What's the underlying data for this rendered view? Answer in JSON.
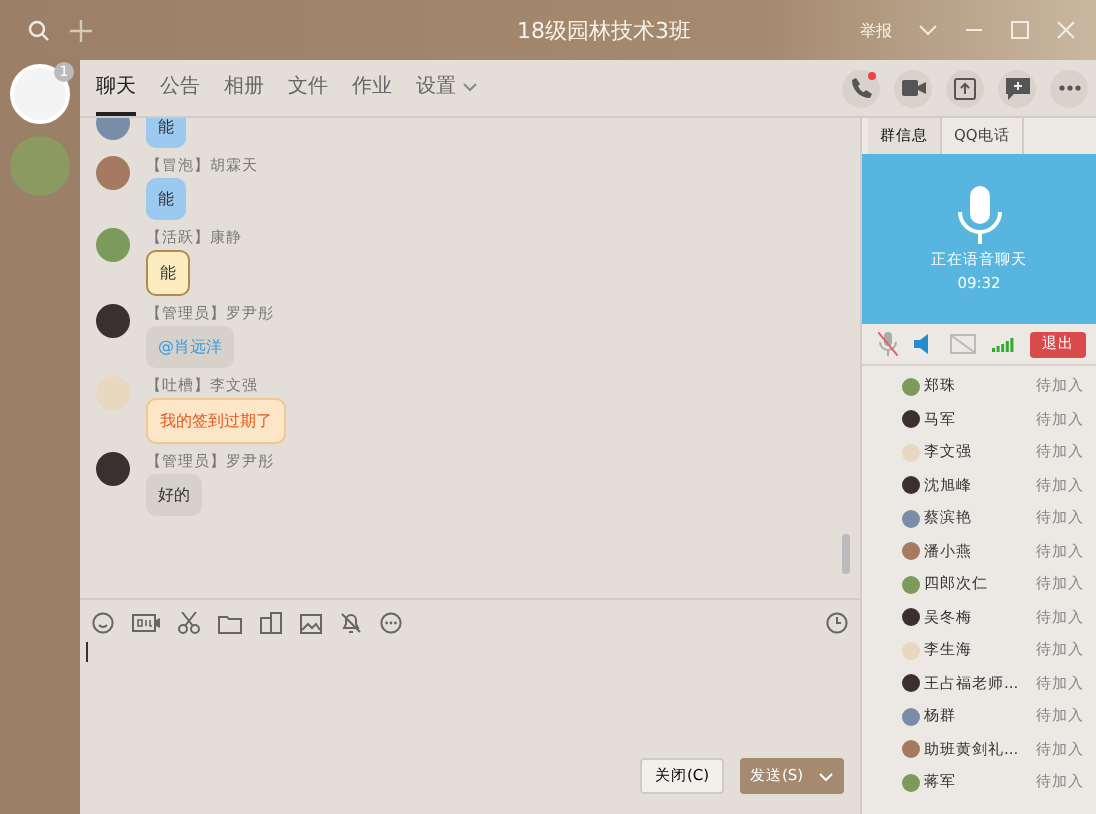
{
  "window": {
    "title": "18级园林技术3班",
    "report": "举报"
  },
  "rail": {
    "items": [
      {
        "badge": "1",
        "selected": true
      },
      {
        "selected": false
      }
    ]
  },
  "tabs": [
    {
      "label": "聊天",
      "selected": true
    },
    {
      "label": "公告",
      "selected": false
    },
    {
      "label": "相册",
      "selected": false
    },
    {
      "label": "文件",
      "selected": false
    },
    {
      "label": "作业",
      "selected": false
    },
    {
      "label": "设置",
      "selected": false,
      "dropdown": true
    }
  ],
  "messages": [
    {
      "text": "能",
      "kind": "blue"
    },
    {
      "sender": "【冒泡】胡霖天",
      "text": "能",
      "kind": "blue"
    },
    {
      "sender": "【活跃】康静",
      "text": "能",
      "kind": "note"
    },
    {
      "sender": "【管理员】罗尹彤",
      "text": "@肖远洋",
      "kind": "mention"
    },
    {
      "sender": "【吐槽】李文强",
      "text": "我的签到过期了",
      "kind": "orange"
    },
    {
      "sender": "【管理员】罗尹彤",
      "text": "好的",
      "kind": "gray"
    }
  ],
  "buttons": {
    "close": "关闭(C)",
    "send": "发送(S)"
  },
  "side_tabs": [
    {
      "label": "群信息",
      "selected": true
    },
    {
      "label": "QQ电话",
      "selected": false
    }
  ],
  "call": {
    "status": "正在语音聊天",
    "time": "09:32",
    "mic_muted": true,
    "camera_on": false,
    "exit": "退出"
  },
  "members": [
    {
      "name": "郑珠",
      "status": "待加入"
    },
    {
      "name": "马军",
      "status": "待加入"
    },
    {
      "name": "李文强",
      "status": "待加入"
    },
    {
      "name": "沈旭峰",
      "status": "待加入"
    },
    {
      "name": "蔡滨艳",
      "status": "待加入"
    },
    {
      "name": "潘小燕",
      "status": "待加入"
    },
    {
      "name": "四郎次仁",
      "status": "待加入"
    },
    {
      "name": "吴冬梅",
      "status": "待加入"
    },
    {
      "name": "李生海",
      "status": "待加入"
    },
    {
      "name": "王占福老师...",
      "status": "待加入"
    },
    {
      "name": "杨群",
      "status": "待加入"
    },
    {
      "name": "助班黄剑礼...",
      "status": "待加入"
    },
    {
      "name": "蒋军",
      "status": "待加入"
    }
  ]
}
